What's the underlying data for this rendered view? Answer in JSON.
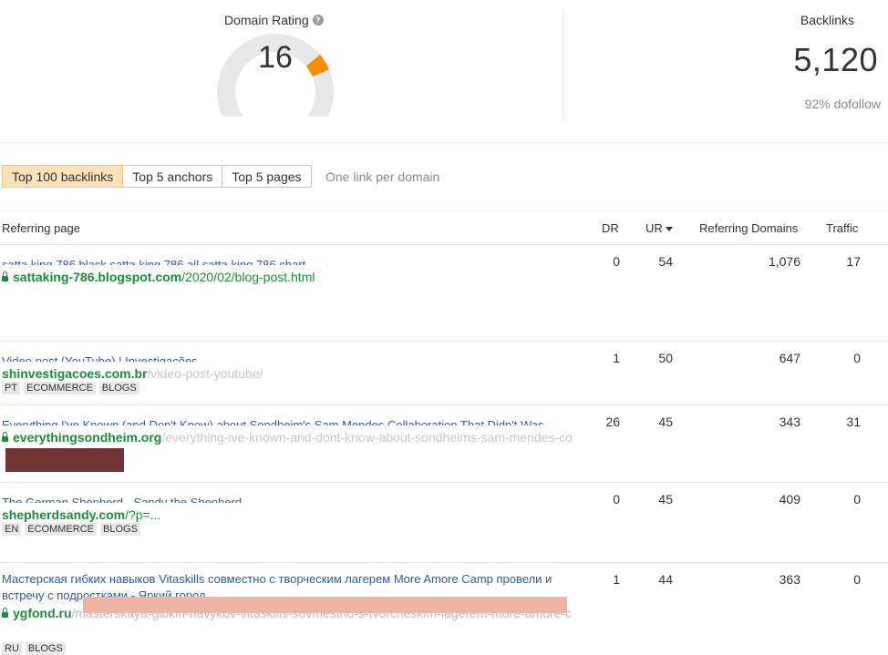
{
  "domain_rating": {
    "label": "Domain Rating",
    "value": "16",
    "gauge_fraction": 0.16,
    "gauge_color": "#f68c0c",
    "track_color": "#e8e8e8"
  },
  "backlinks": {
    "label": "Backlinks",
    "value": "5,120",
    "dofollow": "92% dofollow"
  },
  "tabs": [
    {
      "label": "Top 100 backlinks",
      "active": true
    },
    {
      "label": "Top 5 anchors",
      "active": false
    },
    {
      "label": "Top 5 pages",
      "active": false
    }
  ],
  "tab_note": "One link per domain",
  "table": {
    "headers": {
      "referring_page": "Referring page",
      "dr": "DR",
      "ur": "UR",
      "referring_domains": "Referring Domains",
      "traffic": "Traffic"
    },
    "sort_icon": "caret-down-icon",
    "rows": [
      {
        "title": "satta king 786 black satta king 786 all satta king 786 chart",
        "secure": true,
        "domain": "sattaking-786.blogspot.com",
        "path": "/2020/02/blog-post.html",
        "tags": [],
        "dr": "0",
        "ur": "54",
        "referring_domains": "1,076",
        "traffic": "17"
      },
      {
        "title": "Video post (YouTube) | Investigações",
        "secure": false,
        "domain": "shinvestigacoes.com.br",
        "path": "/video-post-youtube/",
        "tags": [
          "PT",
          "ECOMMERCE",
          "BLOGS"
        ],
        "dr": "1",
        "ur": "50",
        "referring_domains": "647",
        "traffic": "0"
      },
      {
        "title": "Everything I've Known (and Don't Know) about Sondheim's Sam Mendes Collaboration That Didn't Was",
        "secure": true,
        "domain": "everythingsondheim.org",
        "path": "/everything-ive-known-and-dont-know-about-sondheims-sam-mendes-collaboration-that-didnt-was/",
        "tags": [],
        "dr": "26",
        "ur": "45",
        "referring_domains": "343",
        "traffic": "31"
      },
      {
        "title": "The German Shepherd - Sandy the Shepherd",
        "secure": false,
        "domain": "shepherdsandy.com",
        "path": "/?p=...",
        "tags": [
          "EN",
          "ECOMMERCE",
          "BLOGS"
        ],
        "dr": "0",
        "ur": "45",
        "referring_domains": "409",
        "traffic": "0"
      },
      {
        "title": "Мастерская гибких навыков Vitaskills совместно с творческим лагерем More Amore Camp провели и встречу с подростками - Яркий город",
        "secure": true,
        "domain": "ygfond.ru",
        "path": "/masterskaya-gibkih-navykov-vitaskills-sovmestno-s-tvorcheskim-lagerem-more-amore-camp-proveli-vstrechu-s-podrostkami/",
        "tags": [
          "RU",
          "BLOGS"
        ],
        "dr": "1",
        "ur": "44",
        "referring_domains": "363",
        "traffic": "0"
      }
    ]
  }
}
